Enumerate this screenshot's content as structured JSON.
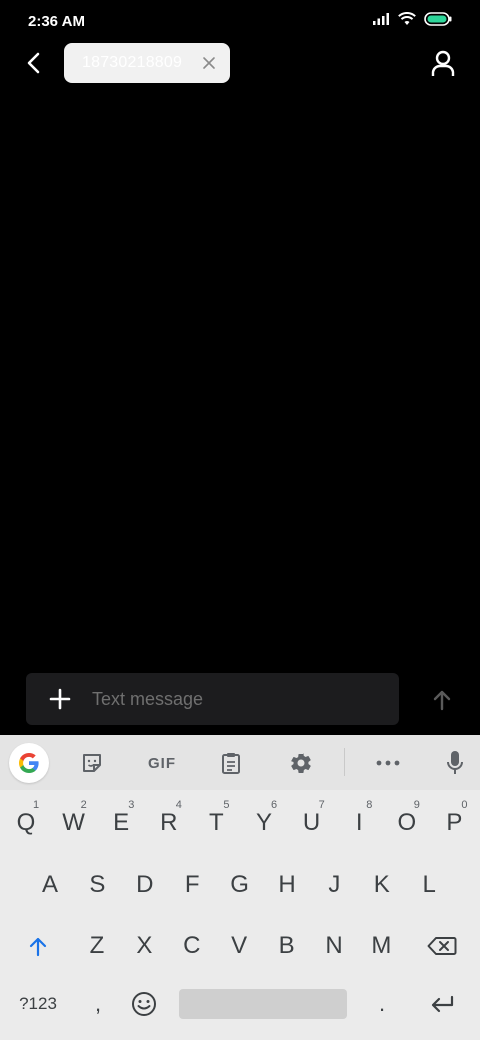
{
  "status_bar": {
    "time": "2:36 AM",
    "battery_color": "#2ed69a"
  },
  "header": {
    "recipient_chip": "18730218809"
  },
  "compose": {
    "placeholder": "Text message"
  },
  "keyboard": {
    "toolbar": {
      "gif_label": "GIF"
    },
    "row1": [
      {
        "key": "Q",
        "hint": "1"
      },
      {
        "key": "W",
        "hint": "2"
      },
      {
        "key": "E",
        "hint": "3"
      },
      {
        "key": "R",
        "hint": "4"
      },
      {
        "key": "T",
        "hint": "5"
      },
      {
        "key": "Y",
        "hint": "6"
      },
      {
        "key": "U",
        "hint": "7"
      },
      {
        "key": "I",
        "hint": "8"
      },
      {
        "key": "O",
        "hint": "9"
      },
      {
        "key": "P",
        "hint": "0"
      }
    ],
    "row2": [
      "A",
      "S",
      "D",
      "F",
      "G",
      "H",
      "J",
      "K",
      "L"
    ],
    "row3": [
      "Z",
      "X",
      "C",
      "V",
      "B",
      "N",
      "M"
    ],
    "bottom_row": {
      "symbols_label": "?123",
      "comma": ",",
      "period": "."
    }
  }
}
